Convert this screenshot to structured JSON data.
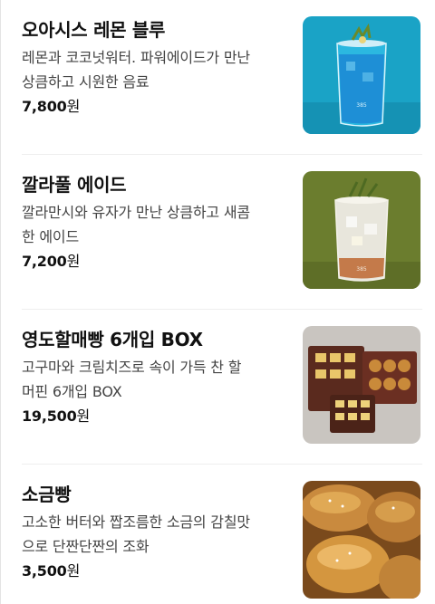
{
  "menu": {
    "items": [
      {
        "name": "오아시스 레몬 블루",
        "desc_line1": "레몬과 코코넛워터. 파워에이드가 만난",
        "desc_line2": "상큼하고 시원한 음료",
        "price": "7,800",
        "currency": "원",
        "image": "blue-lemonade-glass"
      },
      {
        "name": "깔라풀 에이드",
        "desc_line1": "깔라만시와 유자가 만난 상큼하고 새콤",
        "desc_line2": "한 에이드",
        "price": "7,200",
        "currency": "원",
        "image": "calamansi-ade-glass"
      },
      {
        "name": "영도할매빵 6개입 BOX",
        "desc_line1": "고구마와 크림치즈로 속이 가득 찬 할",
        "desc_line2": "머핀 6개입 BOX",
        "price": "19,500",
        "currency": "원",
        "image": "bread-gift-box"
      },
      {
        "name": "소금빵",
        "desc_line1": "고소한 버터와 짭조름한 소금의 감칠맛",
        "desc_line2": "으로 단짠단짠의 조화",
        "price": "3,500",
        "currency": "원",
        "image": "salt-bread"
      }
    ]
  },
  "colors": {
    "blue_bg": "#1aa3c6",
    "green_bg": "#6b7d2e",
    "box_bg": "#c9c5c0",
    "bread_bg": "#7a4a1c"
  }
}
